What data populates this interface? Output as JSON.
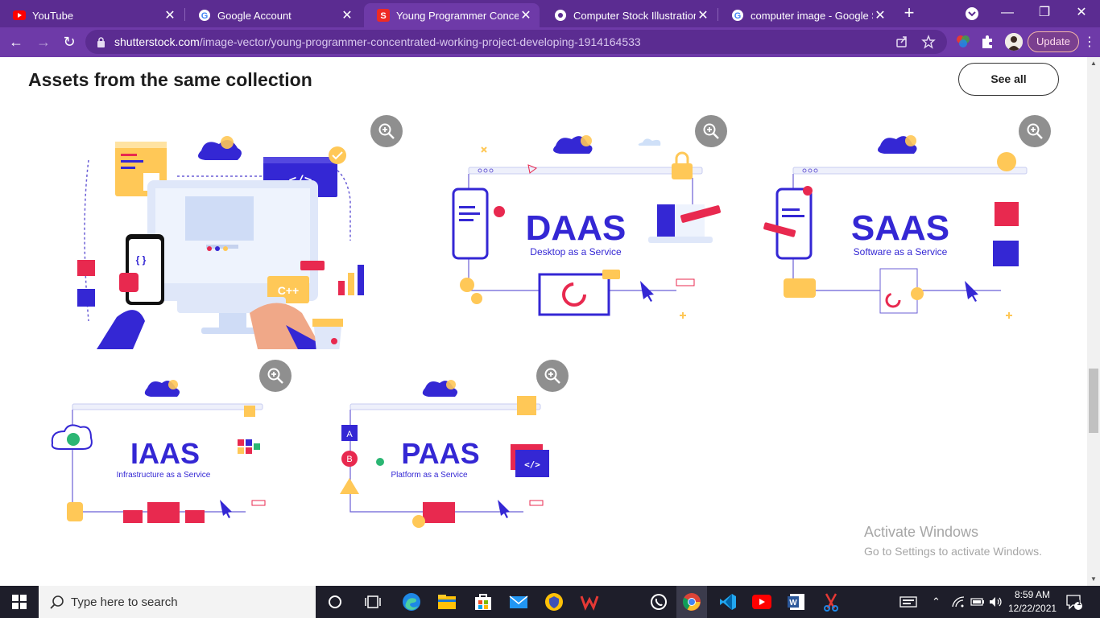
{
  "browser": {
    "tabs": [
      {
        "title": "YouTube",
        "icon": "youtube-icon",
        "active": false
      },
      {
        "title": "Google Account",
        "icon": "google-icon",
        "active": false
      },
      {
        "title": "Young Programmer Concentr",
        "icon": "shutterstock-icon",
        "active": true
      },
      {
        "title": "Computer Stock Illustrations,",
        "icon": "vector-icon",
        "active": false
      },
      {
        "title": "computer image - Google Se",
        "icon": "google-icon",
        "active": false
      }
    ],
    "new_tab": "+",
    "url_host": "shutterstock.com",
    "url_path": "/image-vector/young-programmer-concentrated-working-project-developing-1914164533",
    "update_label": "Update",
    "accent": "#6e3aa8"
  },
  "page": {
    "section_title": "Assets from the same collection",
    "see_all_label": "See all",
    "cards": [
      {
        "id": "programmer",
        "words": []
      },
      {
        "id": "daas",
        "heading": "DAAS",
        "subtitle": "Desktop as a Service"
      },
      {
        "id": "saas",
        "heading": "SAAS",
        "subtitle": "Software as a Service"
      },
      {
        "id": "iaas",
        "heading": "IAAS",
        "subtitle": "Infrastructure as a Service"
      },
      {
        "id": "paas",
        "heading": "PAAS",
        "subtitle": "Platform as a Service"
      }
    ],
    "programmer_labels": {
      "code": "</>",
      "cpp": "C++",
      "brackets": "{ }"
    },
    "paas_labels": {
      "a": "A",
      "b": "B",
      "code": "</>"
    },
    "activate_title": "Activate Windows",
    "activate_sub": "Go to Settings to activate Windows."
  },
  "taskbar": {
    "search_placeholder": "Type here to search",
    "time": "8:59 AM",
    "date": "12/22/2021",
    "notification_count": "1"
  }
}
